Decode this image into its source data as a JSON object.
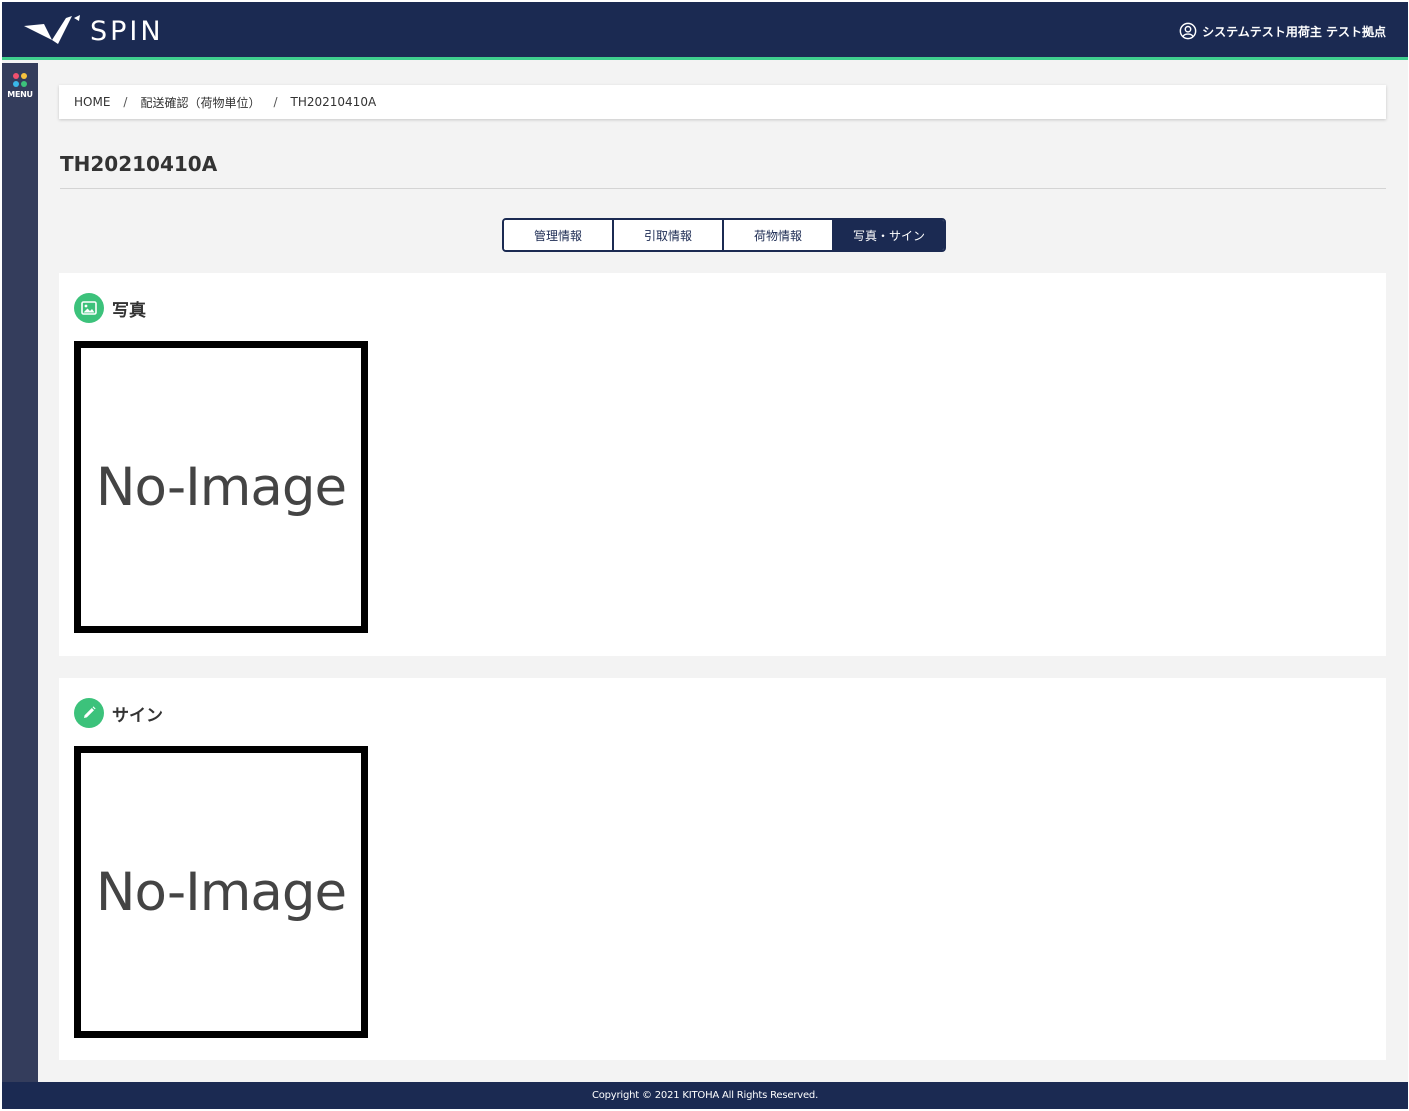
{
  "header": {
    "logo_text": "SPIN",
    "user_name": "システムテスト用荷主 テスト拠点"
  },
  "sidebar": {
    "menu_label": "MENU",
    "menu_dot_colors": [
      "#f0506e",
      "#f6c23e",
      "#3ab7e8",
      "#3cc27b"
    ]
  },
  "breadcrumb": {
    "items": [
      "HOME",
      "配送確認（荷物単位）",
      "TH20210410A"
    ],
    "separator": "/"
  },
  "page": {
    "title": "TH20210410A"
  },
  "tabs": [
    {
      "label": "管理情報",
      "active": false
    },
    {
      "label": "引取情報",
      "active": false
    },
    {
      "label": "荷物情報",
      "active": false
    },
    {
      "label": "写真・サイン",
      "active": true
    }
  ],
  "sections": {
    "photo": {
      "title": "写真",
      "image_text": "No-Image",
      "icon": "image-icon"
    },
    "sign": {
      "title": "サイン",
      "image_text": "No-Image",
      "icon": "pencil-icon"
    }
  },
  "footer": {
    "copyright": "Copyright © 2021 KITOHA All Rights Reserved."
  },
  "colors": {
    "navy": "#1b2a52",
    "accent_green": "#3fcf8e",
    "badge_green": "#3cc27b",
    "sidebar": "#343d5c"
  }
}
